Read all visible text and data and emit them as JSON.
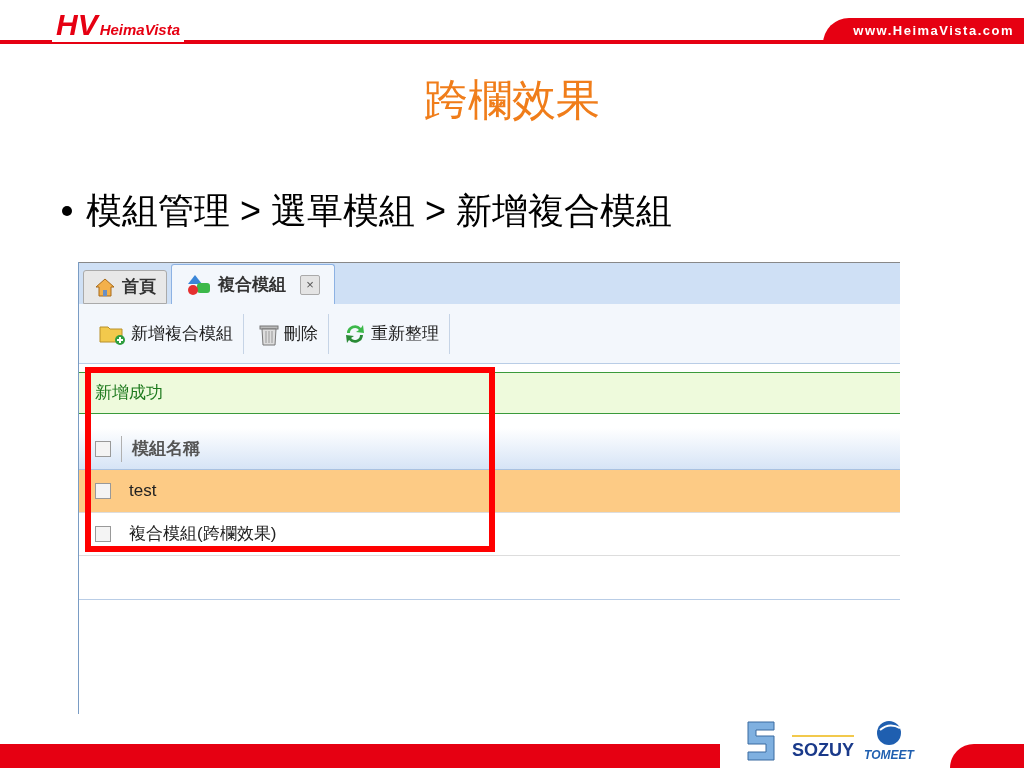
{
  "header": {
    "logo_mark": "HV",
    "logo_text": "HeimaVista",
    "url": "www.HeimaVista.com"
  },
  "title": "跨欄效果",
  "bullet": "模組管理 > 選單模組 > 新增複合模組",
  "screenshot": {
    "tabs": [
      {
        "label": "首頁",
        "selected": false,
        "closable": false,
        "kind": "house"
      },
      {
        "label": "複合模組",
        "selected": true,
        "closable": true,
        "kind": "shapes"
      }
    ],
    "close_glyph": "×",
    "toolbar": [
      {
        "label": "新增複合模組",
        "kind": "folder-add"
      },
      {
        "label": "刪除",
        "kind": "trash"
      },
      {
        "label": "重新整理",
        "kind": "refresh"
      }
    ],
    "message": "新增成功",
    "table": {
      "header_checked": false,
      "column": "模組名稱",
      "rows": [
        {
          "name": "test",
          "selected": true,
          "checked": false
        },
        {
          "name": "複合模組(跨欄效果)",
          "selected": false,
          "checked": false
        }
      ]
    },
    "highlight_box": true
  },
  "footer": {
    "logos": [
      "SOZUY",
      "TOMEET"
    ]
  }
}
